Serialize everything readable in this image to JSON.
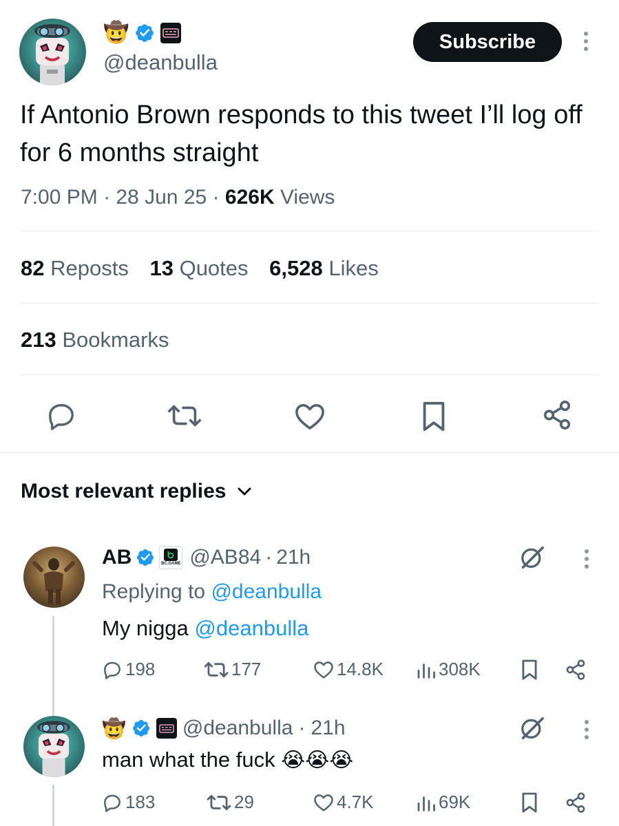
{
  "tweet": {
    "handle": "@deanbulla",
    "subscribe_label": "Subscribe",
    "name_emoji": "🤠",
    "text": "If Antonio Brown responds to this tweet I’ll log off for 6 months straight",
    "time": "7:00 PM",
    "date": "28 Jun 25",
    "sep": "·",
    "views_count": "626K",
    "views_label": "Views",
    "reposts_count": "82",
    "reposts_label": "Reposts",
    "quotes_count": "13",
    "quotes_label": "Quotes",
    "likes_count": "6,528",
    "likes_label": "Likes",
    "bookmarks_count": "213",
    "bookmarks_label": "Bookmarks"
  },
  "replies_header": {
    "label": "Most relevant replies"
  },
  "replies": [
    {
      "name": "AB",
      "affiliate": "BC.GAME",
      "handle": "@AB84",
      "time": "21h",
      "replying_prefix": "Replying to",
      "replying_to": "@deanbulla",
      "text": "My nigga",
      "mention": "@deanbulla",
      "comments": "198",
      "reposts": "177",
      "likes": "14.8K",
      "views": "308K"
    },
    {
      "name_emoji": "🤠",
      "handle": "@deanbulla",
      "time": "21h",
      "text": "man what the fuck",
      "text_emojis": "😭😭😭",
      "comments": "183",
      "reposts": "29",
      "likes": "4.7K",
      "views": "69K"
    }
  ],
  "colors": {
    "accent": "#1d9bf0",
    "text": "#0f1419",
    "secondary": "#536471"
  }
}
